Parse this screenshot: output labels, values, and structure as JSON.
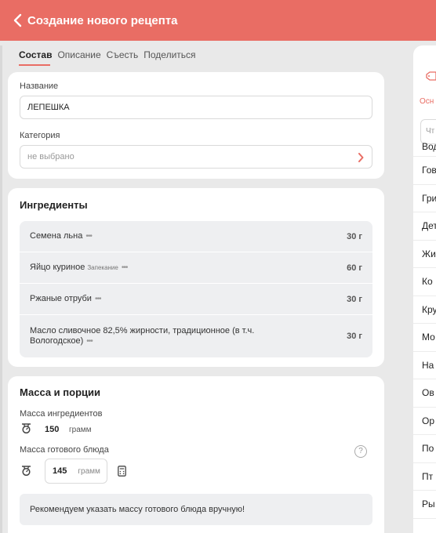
{
  "header": {
    "title": "Создание нового рецепта",
    "back_icon": "chevron-left-icon"
  },
  "tabs": [
    {
      "label": "Состав",
      "active": true
    },
    {
      "label": "Описание",
      "active": false
    },
    {
      "label": "Съесть",
      "active": false
    },
    {
      "label": "Поделиться",
      "active": false
    }
  ],
  "general": {
    "name_label": "Название",
    "name_value": "ЛЕПЕШКА",
    "category_label": "Категория",
    "category_placeholder": "не выбрано"
  },
  "ingredients": {
    "title": "Ингредиенты",
    "items": [
      {
        "name": "Семена льна",
        "tag": "",
        "dots": "•••",
        "amount": "30 г"
      },
      {
        "name": "Яйцо куриное",
        "tag": "Запекание",
        "dots": "•••",
        "amount": "60 г"
      },
      {
        "name": "Ржаные отруби",
        "tag": "",
        "dots": "•••",
        "amount": "30 г"
      },
      {
        "name": "Масло сливочное 82,5% жирности, традиционное (в т.ч. Вологодское)",
        "tag": "",
        "dots": "•••",
        "amount": "30 г"
      }
    ]
  },
  "mass": {
    "title": "Масса и порции",
    "ingredients_mass_label": "Масса ингредиентов",
    "ingredients_mass_value": "150",
    "ingredients_mass_unit": "грамм",
    "dish_mass_label": "Масса готового блюда",
    "dish_mass_value": "145",
    "dish_mass_unit": "грамм",
    "help_symbol": "?",
    "hint": "Рекомендуем указать массу готового блюда вручную!"
  },
  "right_panel": {
    "tab_label": "Осн",
    "search_placeholder": "Чт",
    "items": [
      "Вод",
      "Гов",
      "Гри",
      "Дет",
      "Жи",
      "Ко",
      "Кру",
      "Мо",
      "На",
      "Ов",
      "Ор",
      "По",
      "Пт",
      "Ры"
    ]
  },
  "colors": {
    "accent": "#e96d64",
    "background": "#e9e9e9",
    "card": "#ffffff",
    "row_bg": "#eeeff1"
  }
}
